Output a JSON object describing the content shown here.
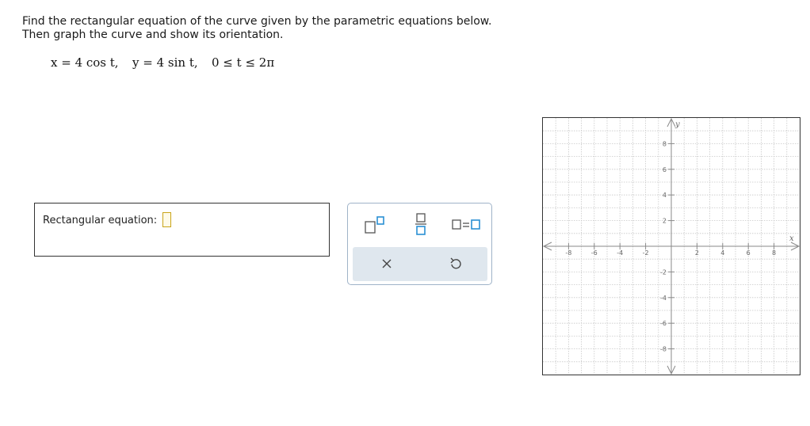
{
  "question": {
    "line1": "Find the rectangular equation of the curve given by the parametric equations below.",
    "line2": "Then graph the curve and show its orientation."
  },
  "equations": {
    "eq1": "x = 4 cos t,",
    "eq2": "y = 4 sin t,",
    "eq3": "0 ≤ t ≤ 2π"
  },
  "answer": {
    "label": "Rectangular equation:",
    "value": ""
  },
  "palette": {
    "buttons": [
      "exponent-template",
      "fraction-template",
      "equation-template"
    ],
    "actions": [
      "clear",
      "undo"
    ],
    "accent": "#2a8fd4",
    "action_bg": "#dfe7ee"
  },
  "graph": {
    "x_axis_label": "x",
    "y_axis_label": "y",
    "xlim": [
      -10,
      10
    ],
    "ylim": [
      -10,
      10
    ],
    "x_ticks": [
      "-8",
      "-6",
      "-4",
      "-2",
      "2",
      "4",
      "6",
      "8"
    ],
    "y_ticks": [
      "8",
      "6",
      "4",
      "2",
      "-2",
      "-4",
      "-6",
      "-8"
    ],
    "grid": true
  }
}
